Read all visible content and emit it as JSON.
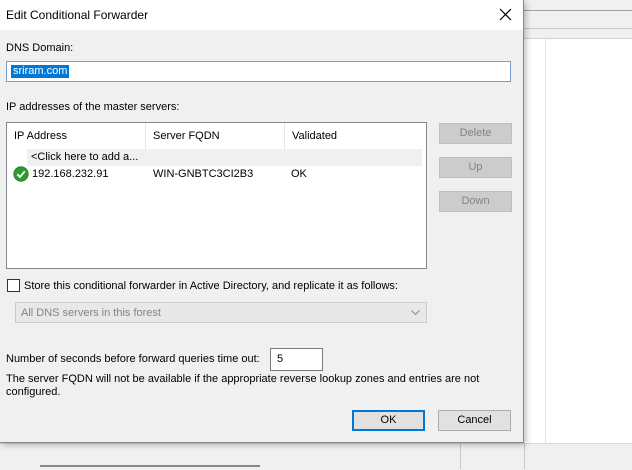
{
  "dialog": {
    "title": "Edit Conditional Forwarder",
    "dns_domain_label": "DNS Domain:",
    "dns_domain_value": "sriram.com",
    "master_servers_label": "IP addresses of the master servers:",
    "grid": {
      "columns": [
        "IP Address",
        "Server FQDN",
        "Validated"
      ],
      "add_row_text": "<Click here to add a...",
      "rows": [
        {
          "ip": "192.168.232.91",
          "fqdn": "WIN-GNBTC3CI2B3",
          "validated": "OK",
          "status_icon": "check-icon"
        }
      ]
    },
    "buttons": {
      "delete": "Delete",
      "up": "Up",
      "down": "Down",
      "ok": "OK",
      "cancel": "Cancel"
    },
    "store_ad_label": "Store this conditional forwarder in Active Directory, and replicate it as follows:",
    "store_ad_checked": false,
    "replication_scope": "All DNS servers in this forest",
    "timeout_label": "Number of seconds before forward queries time out:",
    "timeout_value": "5",
    "note": "The server FQDN will not be available if the appropriate reverse lookup zones and entries are not configured."
  },
  "colors": {
    "accent": "#0078d7",
    "check_green": "#2e9b2e",
    "disabled_text": "#838383"
  }
}
